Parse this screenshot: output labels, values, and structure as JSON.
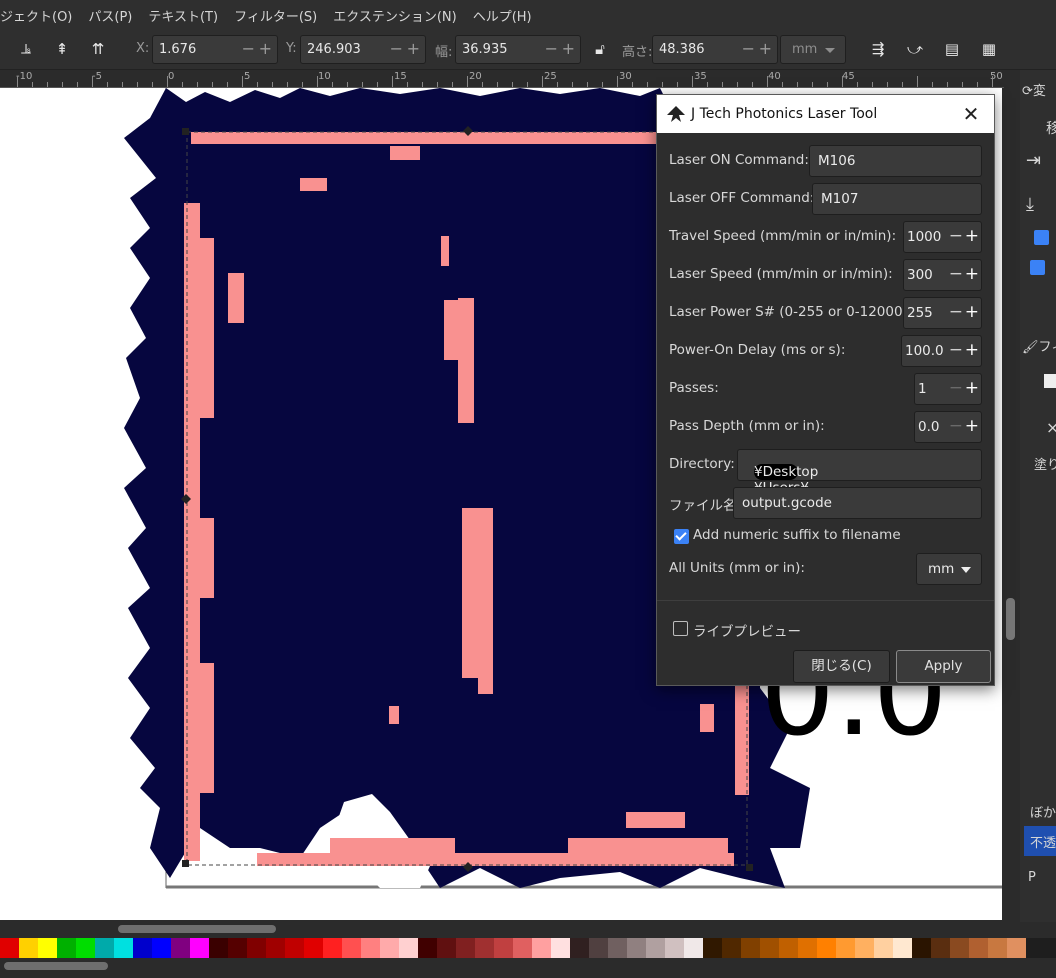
{
  "menubar": [
    "ジェクト(O)",
    "パス(P)",
    "テキスト(T)",
    "フィルター(S)",
    "エクステンション(N)",
    "ヘルプ(H)"
  ],
  "toolbar": {
    "x_label": "X:",
    "x_value": "1.676",
    "y_label": "Y:",
    "y_value": "246.903",
    "w_label": "幅:",
    "w_value": "36.935",
    "h_label": "高さ:",
    "h_value": "48.386",
    "unit": "mm"
  },
  "ruler_ticks": [
    "-10",
    "-5",
    "0",
    "5",
    "10",
    "15",
    "20",
    "25",
    "30",
    "35",
    "40",
    "45",
    "50"
  ],
  "canvas": {
    "big_text": "0.0"
  },
  "dock": [
    "変",
    "移",
    "フィ",
    "塗り",
    "ぼか",
    "不透",
    "P"
  ],
  "dialog": {
    "title": "J Tech Photonics Laser Tool",
    "laser_on_label": "Laser ON Command:",
    "laser_on_value": "M106",
    "laser_off_label": "Laser OFF Command:",
    "laser_off_value": "M107",
    "travel_label": "Travel Speed (mm/min or in/min):",
    "travel_value": "1000",
    "laser_speed_label": "Laser Speed (mm/min or in/min):",
    "laser_speed_value": "300",
    "power_label": "Laser Power S# (0-255 or 0-12000):",
    "power_value": "255",
    "delay_label": "Power-On Delay (ms or s):",
    "delay_value": "100.0",
    "passes_label": "Passes:",
    "passes_value": "1",
    "depth_label": "Pass Depth (mm or in):",
    "depth_value": "0.0",
    "directory_label": "Directory:",
    "directory_value_prefix": "C:¥Users¥",
    "directory_value_suffix": "¥Desktop",
    "filename_label": "ファイル名:",
    "filename_value": "output.gcode",
    "suffix_label": "Add numeric suffix to filename",
    "units_label": "All Units (mm or in):",
    "units_value": "mm",
    "preview_label": "ライブプレビュー",
    "close_label": "閉じる(C)",
    "apply_label": "Apply"
  },
  "palette": [
    "#e00000",
    "#ffd000",
    "#ffff00",
    "#00b000",
    "#00dd00",
    "#00aaaa",
    "#00e0e0",
    "#0000cc",
    "#0000ff",
    "#800080",
    "#ff00ff",
    "#3a0000",
    "#550000",
    "#800000",
    "#a00000",
    "#c00000",
    "#e00000",
    "#ff2020",
    "#ff5050",
    "#ff8080",
    "#ffaaaa",
    "#ffd0d0",
    "#400000",
    "#601010",
    "#802020",
    "#a03030",
    "#c04040",
    "#e06060",
    "#ffa0a0",
    "#ffe0e0",
    "#302020",
    "#504040",
    "#706060",
    "#908080",
    "#b0a0a0",
    "#d0c0c0",
    "#f0e8e8",
    "#301800",
    "#502800",
    "#804000",
    "#a05000",
    "#c06000",
    "#e07000",
    "#ff8000",
    "#ff9a30",
    "#ffb060",
    "#ffd0a0",
    "#ffe8d0",
    "#2a1400",
    "#5a2e10",
    "#8a4a20",
    "#b06030",
    "#c87840",
    "#e09060"
  ]
}
